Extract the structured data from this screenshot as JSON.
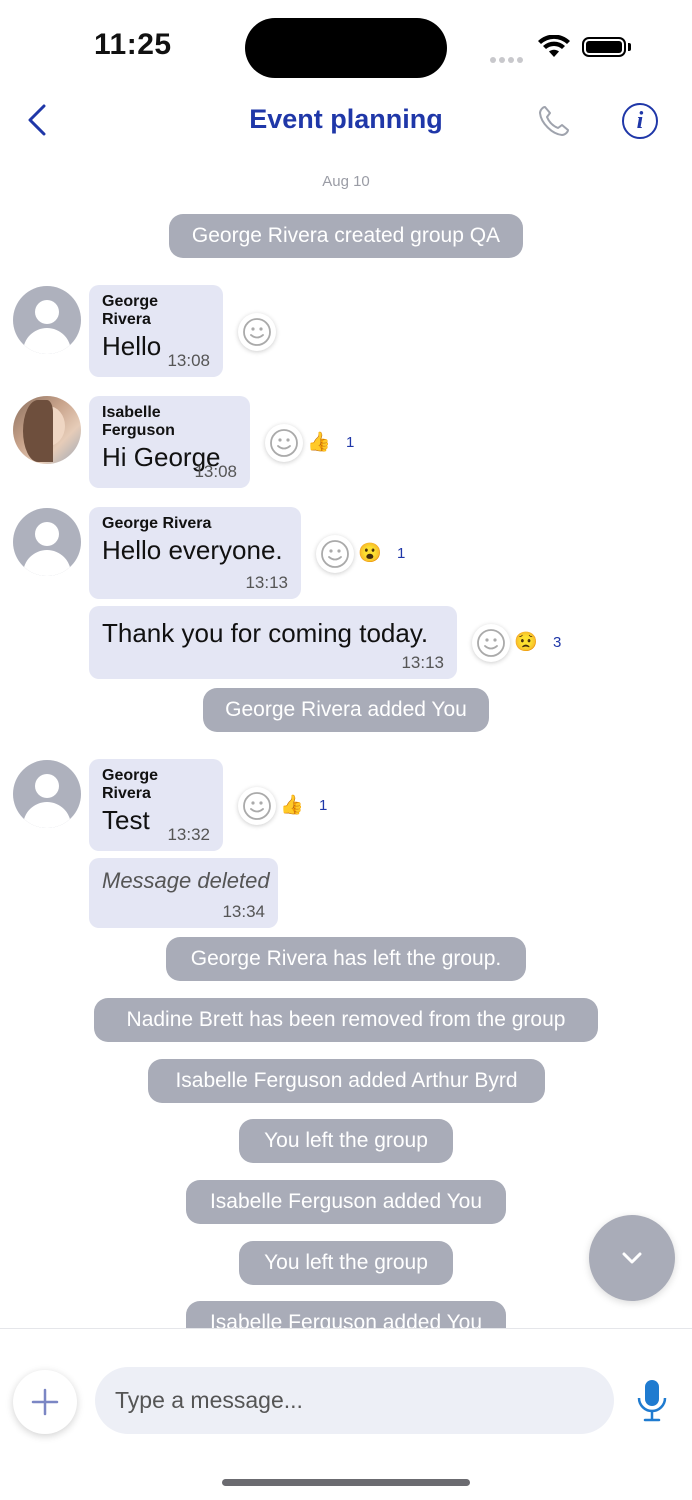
{
  "status_bar": {
    "time": "11:25"
  },
  "header": {
    "title": "Event planning"
  },
  "date_divider": "Aug 10",
  "system": {
    "created": "George Rivera created group QA",
    "added_you": "George Rivera added You",
    "left": "George Rivera has left the group.",
    "removed": "Nadine Brett has been removed from the group",
    "added_arthur": "Isabelle Ferguson added Arthur Byrd",
    "you_left_1": "You left the group",
    "isabelle_added_you_1": "Isabelle Ferguson added You",
    "you_left_2": "You left the group",
    "isabelle_added_you_2": "Isabelle Ferguson added You"
  },
  "messages": [
    {
      "sender": "George Rivera",
      "text": "Hello",
      "time": "13:08"
    },
    {
      "sender": "Isabelle Ferguson",
      "text": "Hi George",
      "time": "13:08",
      "reaction": "👍",
      "count": "1"
    },
    {
      "sender": "George Rivera",
      "text": "Hello everyone.",
      "time": "13:13",
      "reaction": "😮",
      "count": "1"
    },
    {
      "text": "Thank you for coming today.",
      "time": "13:13",
      "reaction": "😟",
      "count": "3"
    },
    {
      "sender": "George Rivera",
      "text": "Test",
      "time": "13:32",
      "reaction": "👍",
      "count": "1"
    },
    {
      "text": "Message deleted",
      "time": "13:34"
    }
  ],
  "composer": {
    "placeholder": "Type a message..."
  },
  "colors": {
    "accent": "#1f37a8",
    "bubble": "#e4e6f4",
    "system_pill": "#a9acb8"
  },
  "icons": [
    "back-chevron-icon",
    "phone-icon",
    "info-icon",
    "smile-react-icon",
    "chevron-down-icon",
    "plus-icon",
    "mic-icon"
  ]
}
